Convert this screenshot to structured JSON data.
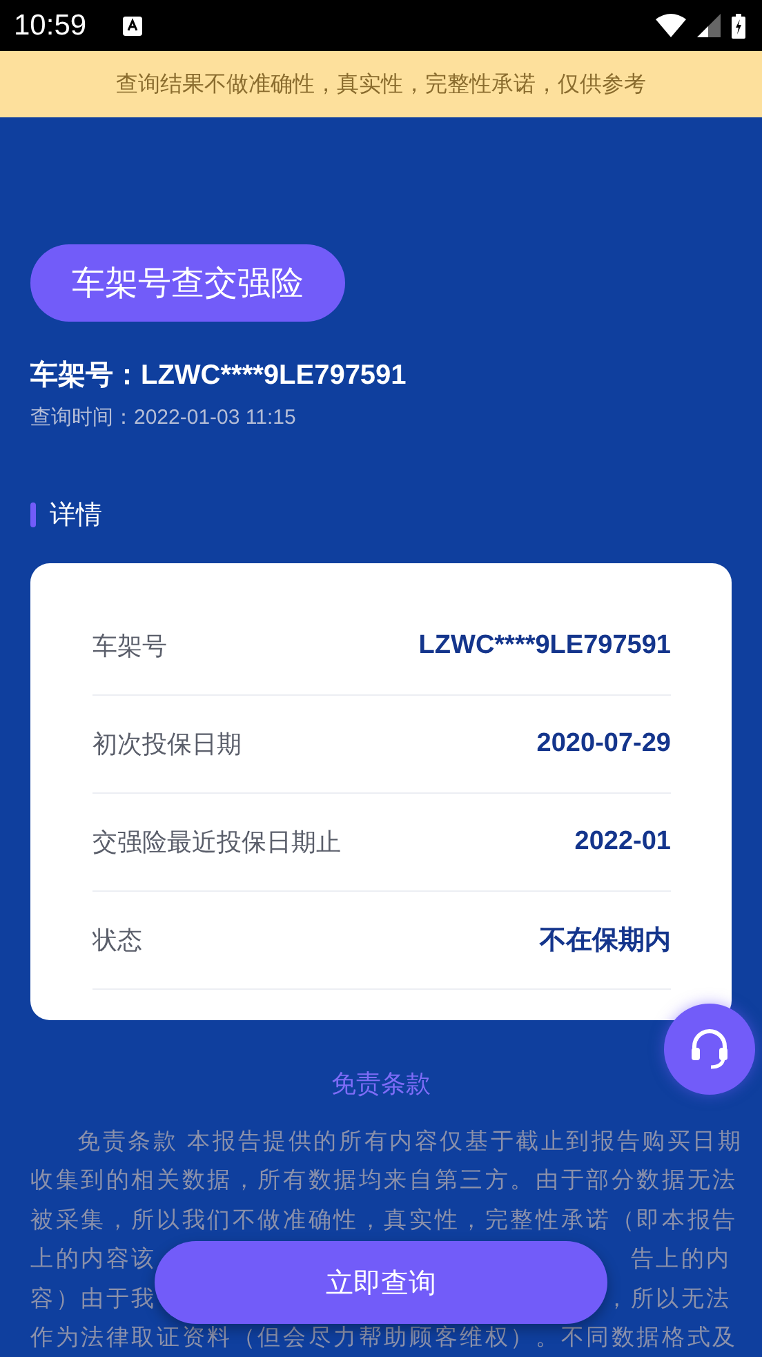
{
  "status_bar": {
    "time": "10:59"
  },
  "notice": "查询结果不做准确性，真实性，完整性承诺，仅供参考",
  "query_title": "车架号查交强险",
  "vin_line": "车架号：LZWC****9LE797591",
  "query_time": "查询时间：2022-01-03 11:15",
  "section_title": "详情",
  "details": [
    {
      "label": "车架号",
      "value": "LZWC****9LE797591"
    },
    {
      "label": "初次投保日期",
      "value": "2020-07-29"
    },
    {
      "label": "交强险最近投保日期止",
      "value": "2022-01"
    },
    {
      "label": "状态",
      "value": "不在保期内"
    }
  ],
  "disclaimer": {
    "title": "免责条款",
    "lines": [
      {
        "kind": "first",
        "parts": [
          "免责条款 本报告提供的所有内容仅基于截止到报告购买日期"
        ]
      },
      {
        "kind": "full",
        "parts": [
          "收集到的相关数据，所有数据均来自第三方。由于部分数据无法"
        ]
      },
      {
        "kind": "full",
        "parts": [
          "被采集，所以我们不做准确性，真实性，完整性承诺（即本报告"
        ]
      },
      {
        "kind": "split",
        "parts": [
          "上的内容该",
          "告上的内"
        ]
      },
      {
        "kind": "split",
        "parts": [
          "容）由于我",
          "，所以无法"
        ]
      },
      {
        "kind": "full",
        "parts": [
          "作为法律取证资料（但会尽力帮助顾客维权）。不同数据格式及"
        ]
      }
    ]
  },
  "query_button": "立即查询"
}
